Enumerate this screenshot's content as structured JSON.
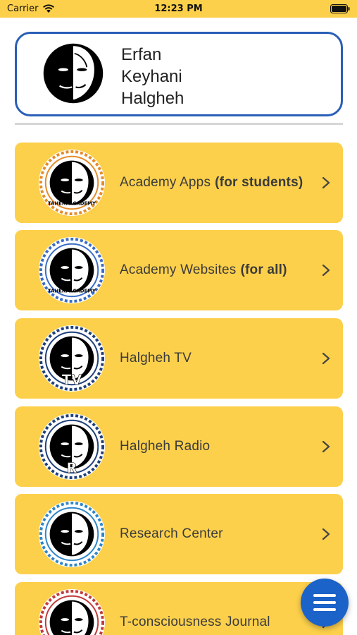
{
  "status_bar": {
    "carrier": "Carrier",
    "time": "12:23 PM"
  },
  "profile": {
    "name_line1": "Erfan",
    "name_line2": "Keyhani",
    "name_line3": "Halgheh"
  },
  "menu": {
    "items": [
      {
        "label": "Academy Apps",
        "emphasis": "(for students)",
        "logo_ring": "#e48b2a",
        "logo_text": "TAHERI ACADEMY",
        "icon": "academy-apps-logo-icon"
      },
      {
        "label": "Academy Websites",
        "emphasis": "(for all)",
        "logo_ring": "#3a6cc5",
        "logo_text": "TAHERI ACADEMY",
        "icon": "academy-websites-logo-icon"
      },
      {
        "label": "Halgheh TV",
        "emphasis": "",
        "logo_ring": "#1e3f7a",
        "logo_text": "TV",
        "icon": "halgheh-tv-logo-icon"
      },
      {
        "label": "Halgheh Radio",
        "emphasis": "",
        "logo_ring": "#1e3f7a",
        "logo_text": "R",
        "icon": "halgheh-radio-logo-icon"
      },
      {
        "label": "Research Center",
        "emphasis": "",
        "logo_ring": "#2e86c8",
        "logo_text": "",
        "icon": "research-center-logo-icon"
      },
      {
        "label": "T-consciousness Journal",
        "emphasis": "",
        "logo_ring": "#c23b3b",
        "logo_text": "",
        "icon": "journal-logo-icon"
      }
    ]
  },
  "colors": {
    "accent": "#fdd04b",
    "border": "#2a5fb8",
    "fab": "#1c63c9"
  },
  "fab": {
    "icon": "hamburger-menu-icon"
  }
}
